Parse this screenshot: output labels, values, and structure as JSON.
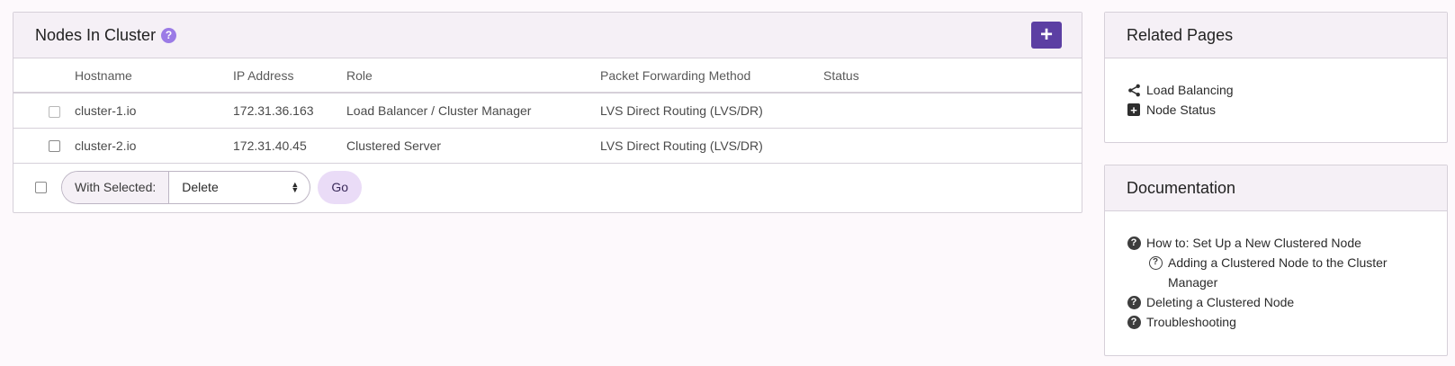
{
  "nodes_panel": {
    "title": "Nodes In Cluster",
    "help_icon": "question-circle-icon",
    "add_icon": "plus-icon",
    "columns": [
      "Hostname",
      "IP Address",
      "Role",
      "Packet Forwarding Method",
      "Status"
    ],
    "rows": [
      {
        "hostname": "cluster-1.io",
        "ip": "172.31.36.163",
        "role": "Load Balancer / Cluster Manager",
        "method": "LVS Direct Routing (LVS/DR)",
        "status": ""
      },
      {
        "hostname": "cluster-2.io",
        "ip": "172.31.40.45",
        "role": "Clustered Server",
        "method": "LVS Direct Routing (LVS/DR)",
        "status": ""
      }
    ],
    "bulk": {
      "with_selected_label": "With Selected:",
      "selected_action": "Delete",
      "go_label": "Go"
    }
  },
  "related_pages": {
    "title": "Related Pages",
    "links": [
      {
        "label": "Load Balancing",
        "icon": "share-icon"
      },
      {
        "label": "Node Status",
        "icon": "plus-square-icon"
      }
    ]
  },
  "documentation": {
    "title": "Documentation",
    "links": [
      {
        "label": "How to: Set Up a New Clustered Node",
        "icon": "question-circle-icon"
      },
      {
        "label": "Adding a Clustered Node to the Cluster Manager",
        "icon": "question-circle-outline-icon"
      },
      {
        "label": "Deleting a Clustered Node",
        "icon": "question-circle-icon"
      },
      {
        "label": "Troubleshooting",
        "icon": "question-circle-icon"
      }
    ]
  },
  "colors": {
    "accent": "#5c3fa3",
    "help_badge": "#9b7be6",
    "go_button": "#eadcf7",
    "panel_header": "#f5f0f6"
  }
}
